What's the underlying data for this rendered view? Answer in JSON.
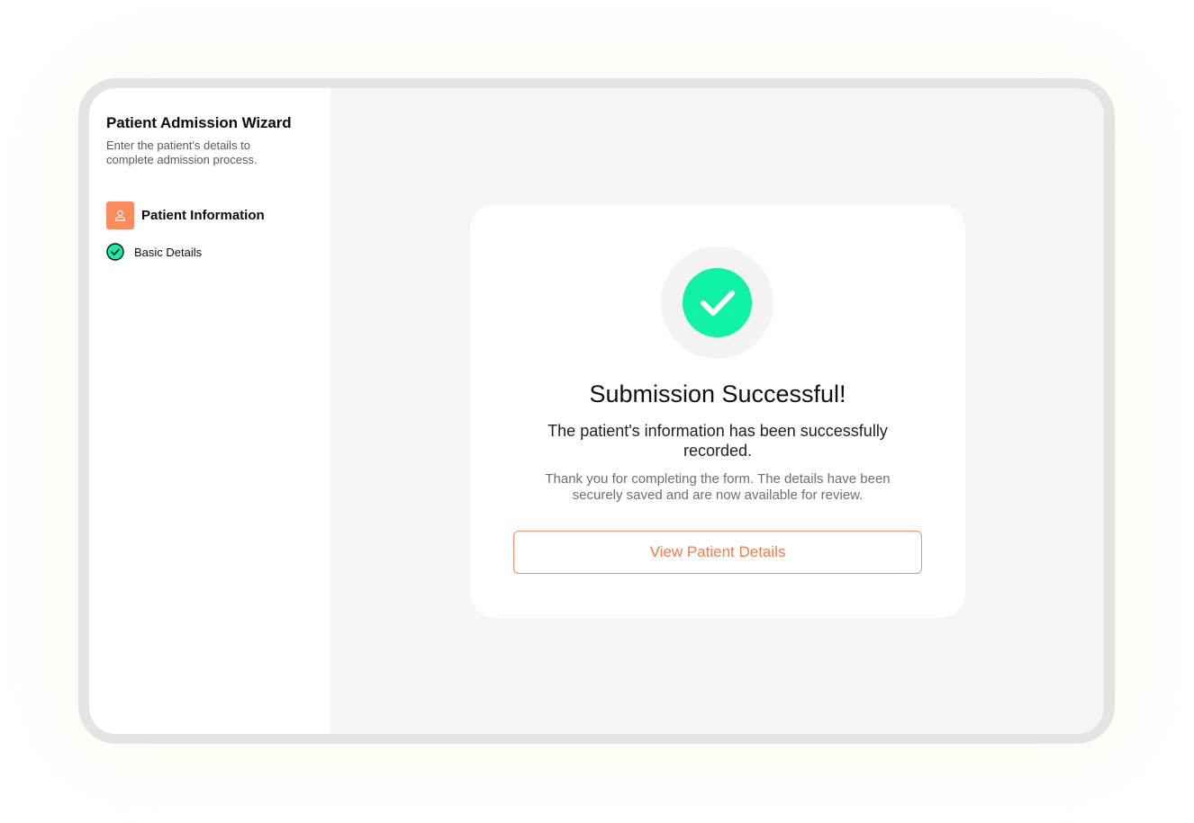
{
  "sidebar": {
    "title": "Patient Admission Wizard",
    "subtitle": "Enter the patient's details to complete admission process.",
    "section": {
      "icon": "user-icon",
      "label": "Patient Information"
    },
    "steps": [
      {
        "icon": "check-circle-icon",
        "label": "Basic Details",
        "status": "completed"
      }
    ]
  },
  "card": {
    "icon": "checkmark-icon",
    "heading": "Submission Successful!",
    "subheading": "The patient's information has been successfully recorded.",
    "body": "Thank you for completing the form. The details have been securely saved and are now available for review.",
    "button_label": "View Patient Details"
  },
  "colors": {
    "accent": "#fb8a5c",
    "success": "#0ff2a2",
    "main_background": "#f4f5f7",
    "device_frame": "#e4e4e4"
  }
}
